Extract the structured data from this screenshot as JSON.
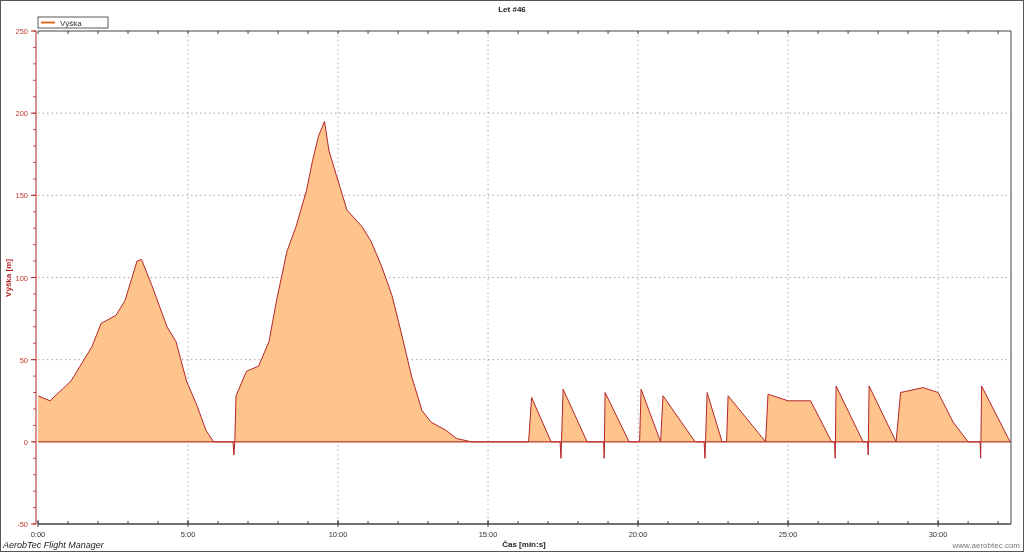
{
  "chart_data": {
    "type": "area",
    "title": "Let #46",
    "xlabel": "Čas [min:s]",
    "ylabel": "Výška [m]",
    "x": [
      0,
      0.4,
      1.1,
      1.8,
      2.1,
      2.6,
      2.9,
      3.3,
      3.45,
      3.8,
      4.3,
      4.6,
      4.95,
      5.3,
      5.6,
      5.85,
      6.5,
      6.53,
      6.56,
      6.6,
      6.95,
      7.35,
      7.7,
      7.95,
      8.3,
      8.6,
      8.95,
      9.15,
      9.35,
      9.55,
      9.7,
      9.95,
      10.3,
      10.8,
      11.1,
      11.45,
      11.8,
      12.1,
      12.45,
      12.8,
      13.1,
      13.6,
      13.95,
      14.45,
      16.35,
      16.45,
      17.1,
      17.4,
      17.43,
      17.5,
      18.3,
      18.85,
      18.87,
      18.9,
      19.7,
      20.05,
      20.1,
      20.75,
      20.83,
      21.9,
      22.2,
      22.23,
      22.3,
      22.8,
      22.95,
      23.0,
      24.25,
      24.33,
      25.0,
      25.75,
      26.45,
      26.55,
      26.57,
      26.6,
      27.5,
      27.65,
      27.67,
      27.7,
      28.6,
      28.75,
      29.5,
      30.0,
      30.5,
      31.0,
      31.4,
      31.42,
      31.45,
      32.4
    ],
    "series": [
      {
        "name": "Výška",
        "color": "#ffc48c",
        "values": [
          28,
          25,
          37,
          58,
          72,
          77,
          86,
          110,
          111,
          95,
          70,
          61,
          37,
          22,
          7,
          0,
          0,
          -8,
          0,
          28,
          43,
          46,
          61,
          86,
          116,
          131,
          153,
          171,
          186,
          195,
          177,
          162,
          141,
          131,
          122,
          107,
          89,
          67,
          40,
          19,
          12,
          7,
          2,
          0,
          0,
          27,
          0,
          0,
          -10,
          32,
          0,
          0,
          -10,
          30,
          0,
          0,
          32,
          0,
          28,
          0,
          0,
          -10,
          30,
          0,
          0,
          28,
          0,
          29,
          25,
          25,
          0,
          0,
          -10,
          34,
          0,
          0,
          -8,
          34,
          0,
          30,
          33,
          30,
          12,
          0,
          0,
          -10,
          34,
          0
        ]
      }
    ],
    "xlim": [
      0,
      32.43
    ],
    "ylim": [
      -50,
      250
    ],
    "xticks": [
      {
        "value": 0,
        "label": "0:00"
      },
      {
        "value": 5,
        "label": "5:00"
      },
      {
        "value": 10,
        "label": "10:00"
      },
      {
        "value": 15,
        "label": "15:00"
      },
      {
        "value": 20,
        "label": "20:00"
      },
      {
        "value": 25,
        "label": "25:00"
      },
      {
        "value": 30,
        "label": "30:00"
      }
    ],
    "yticks": [
      -50,
      0,
      50,
      100,
      150,
      200,
      250
    ],
    "grid": true,
    "ref_lines": [
      {
        "axis": "y",
        "value": 0
      }
    ]
  },
  "footer": {
    "app_name": "AerobTec Flight Manager",
    "website": "www.aerobtec.com"
  }
}
